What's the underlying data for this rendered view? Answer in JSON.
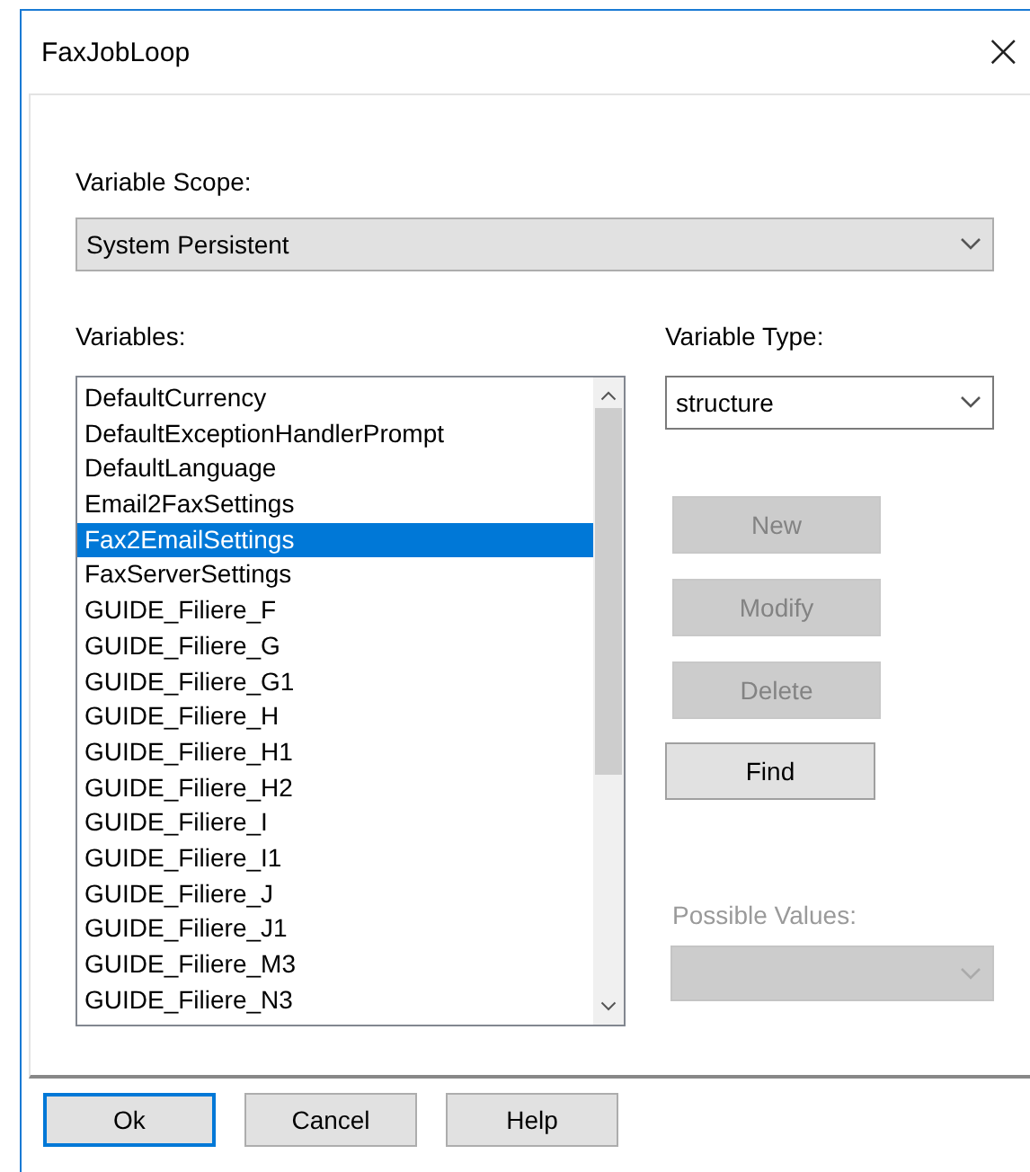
{
  "window": {
    "title": "FaxJobLoop",
    "close": "×"
  },
  "scope": {
    "label": "Variable Scope:",
    "value": "System Persistent"
  },
  "variables": {
    "label": "Variables:",
    "items": [
      {
        "text": "DefaultCurrency",
        "selected": false
      },
      {
        "text": "DefaultExceptionHandlerPrompt",
        "selected": false
      },
      {
        "text": "DefaultLanguage",
        "selected": false
      },
      {
        "text": "Email2FaxSettings",
        "selected": false
      },
      {
        "text": "Fax2EmailSettings",
        "selected": true
      },
      {
        "text": "FaxServerSettings",
        "selected": false
      },
      {
        "text": "GUIDE_Filiere_F",
        "selected": false
      },
      {
        "text": "GUIDE_Filiere_G",
        "selected": false
      },
      {
        "text": "GUIDE_Filiere_G1",
        "selected": false
      },
      {
        "text": "GUIDE_Filiere_H",
        "selected": false
      },
      {
        "text": "GUIDE_Filiere_H1",
        "selected": false
      },
      {
        "text": "GUIDE_Filiere_H2",
        "selected": false
      },
      {
        "text": "GUIDE_Filiere_I",
        "selected": false
      },
      {
        "text": "GUIDE_Filiere_I1",
        "selected": false
      },
      {
        "text": "GUIDE_Filiere_J",
        "selected": false
      },
      {
        "text": "GUIDE_Filiere_J1",
        "selected": false
      },
      {
        "text": "GUIDE_Filiere_M3",
        "selected": false
      },
      {
        "text": "GUIDE_Filiere_N3",
        "selected": false
      }
    ]
  },
  "variable_type": {
    "label": "Variable Type:",
    "value": "structure"
  },
  "actions": [
    {
      "label": "New",
      "disabled": true
    },
    {
      "label": "Modify",
      "disabled": true
    },
    {
      "label": "Delete",
      "disabled": true
    },
    {
      "label": "Find",
      "disabled": false
    }
  ],
  "possible_values": {
    "label": "Possible Values:",
    "disabled": true
  },
  "buttons": [
    {
      "label": "Ok",
      "default": true
    },
    {
      "label": "Cancel",
      "default": false
    },
    {
      "label": "Help",
      "default": false
    }
  ]
}
